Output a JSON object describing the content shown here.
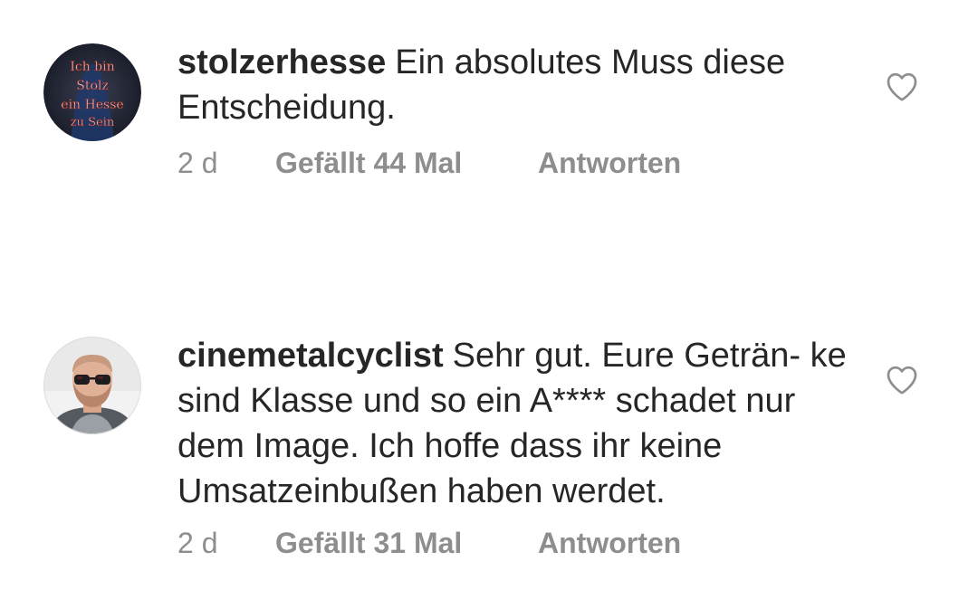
{
  "comments": [
    {
      "username": "stolzerhesse",
      "text": "Ein absolutes Muss diese Entscheidung.",
      "time": "2 d",
      "likes": "Gefällt 44 Mal",
      "reply": "Antworten",
      "avatar_icon": "ich-bin-stolz-badge",
      "avatar_text": [
        "Ich bin",
        "Stolz",
        "ein Hesse",
        "zu Sein"
      ]
    },
    {
      "username": "cinemetalcyclist",
      "text": "Sehr gut. Eure Geträn- ke sind Klasse und so ein A**** schadet nur dem Image. Ich hoffe dass ihr keine Umsatzeinbußen haben werdet.",
      "time": "2 d",
      "likes": "Gefällt 31 Mal",
      "reply": "Antworten",
      "avatar_icon": "profile-photo-man-sunglasses"
    }
  ],
  "colors": {
    "text": "#262626",
    "meta": "#8e8e8e",
    "heart_outline": "#8e8e8e"
  }
}
